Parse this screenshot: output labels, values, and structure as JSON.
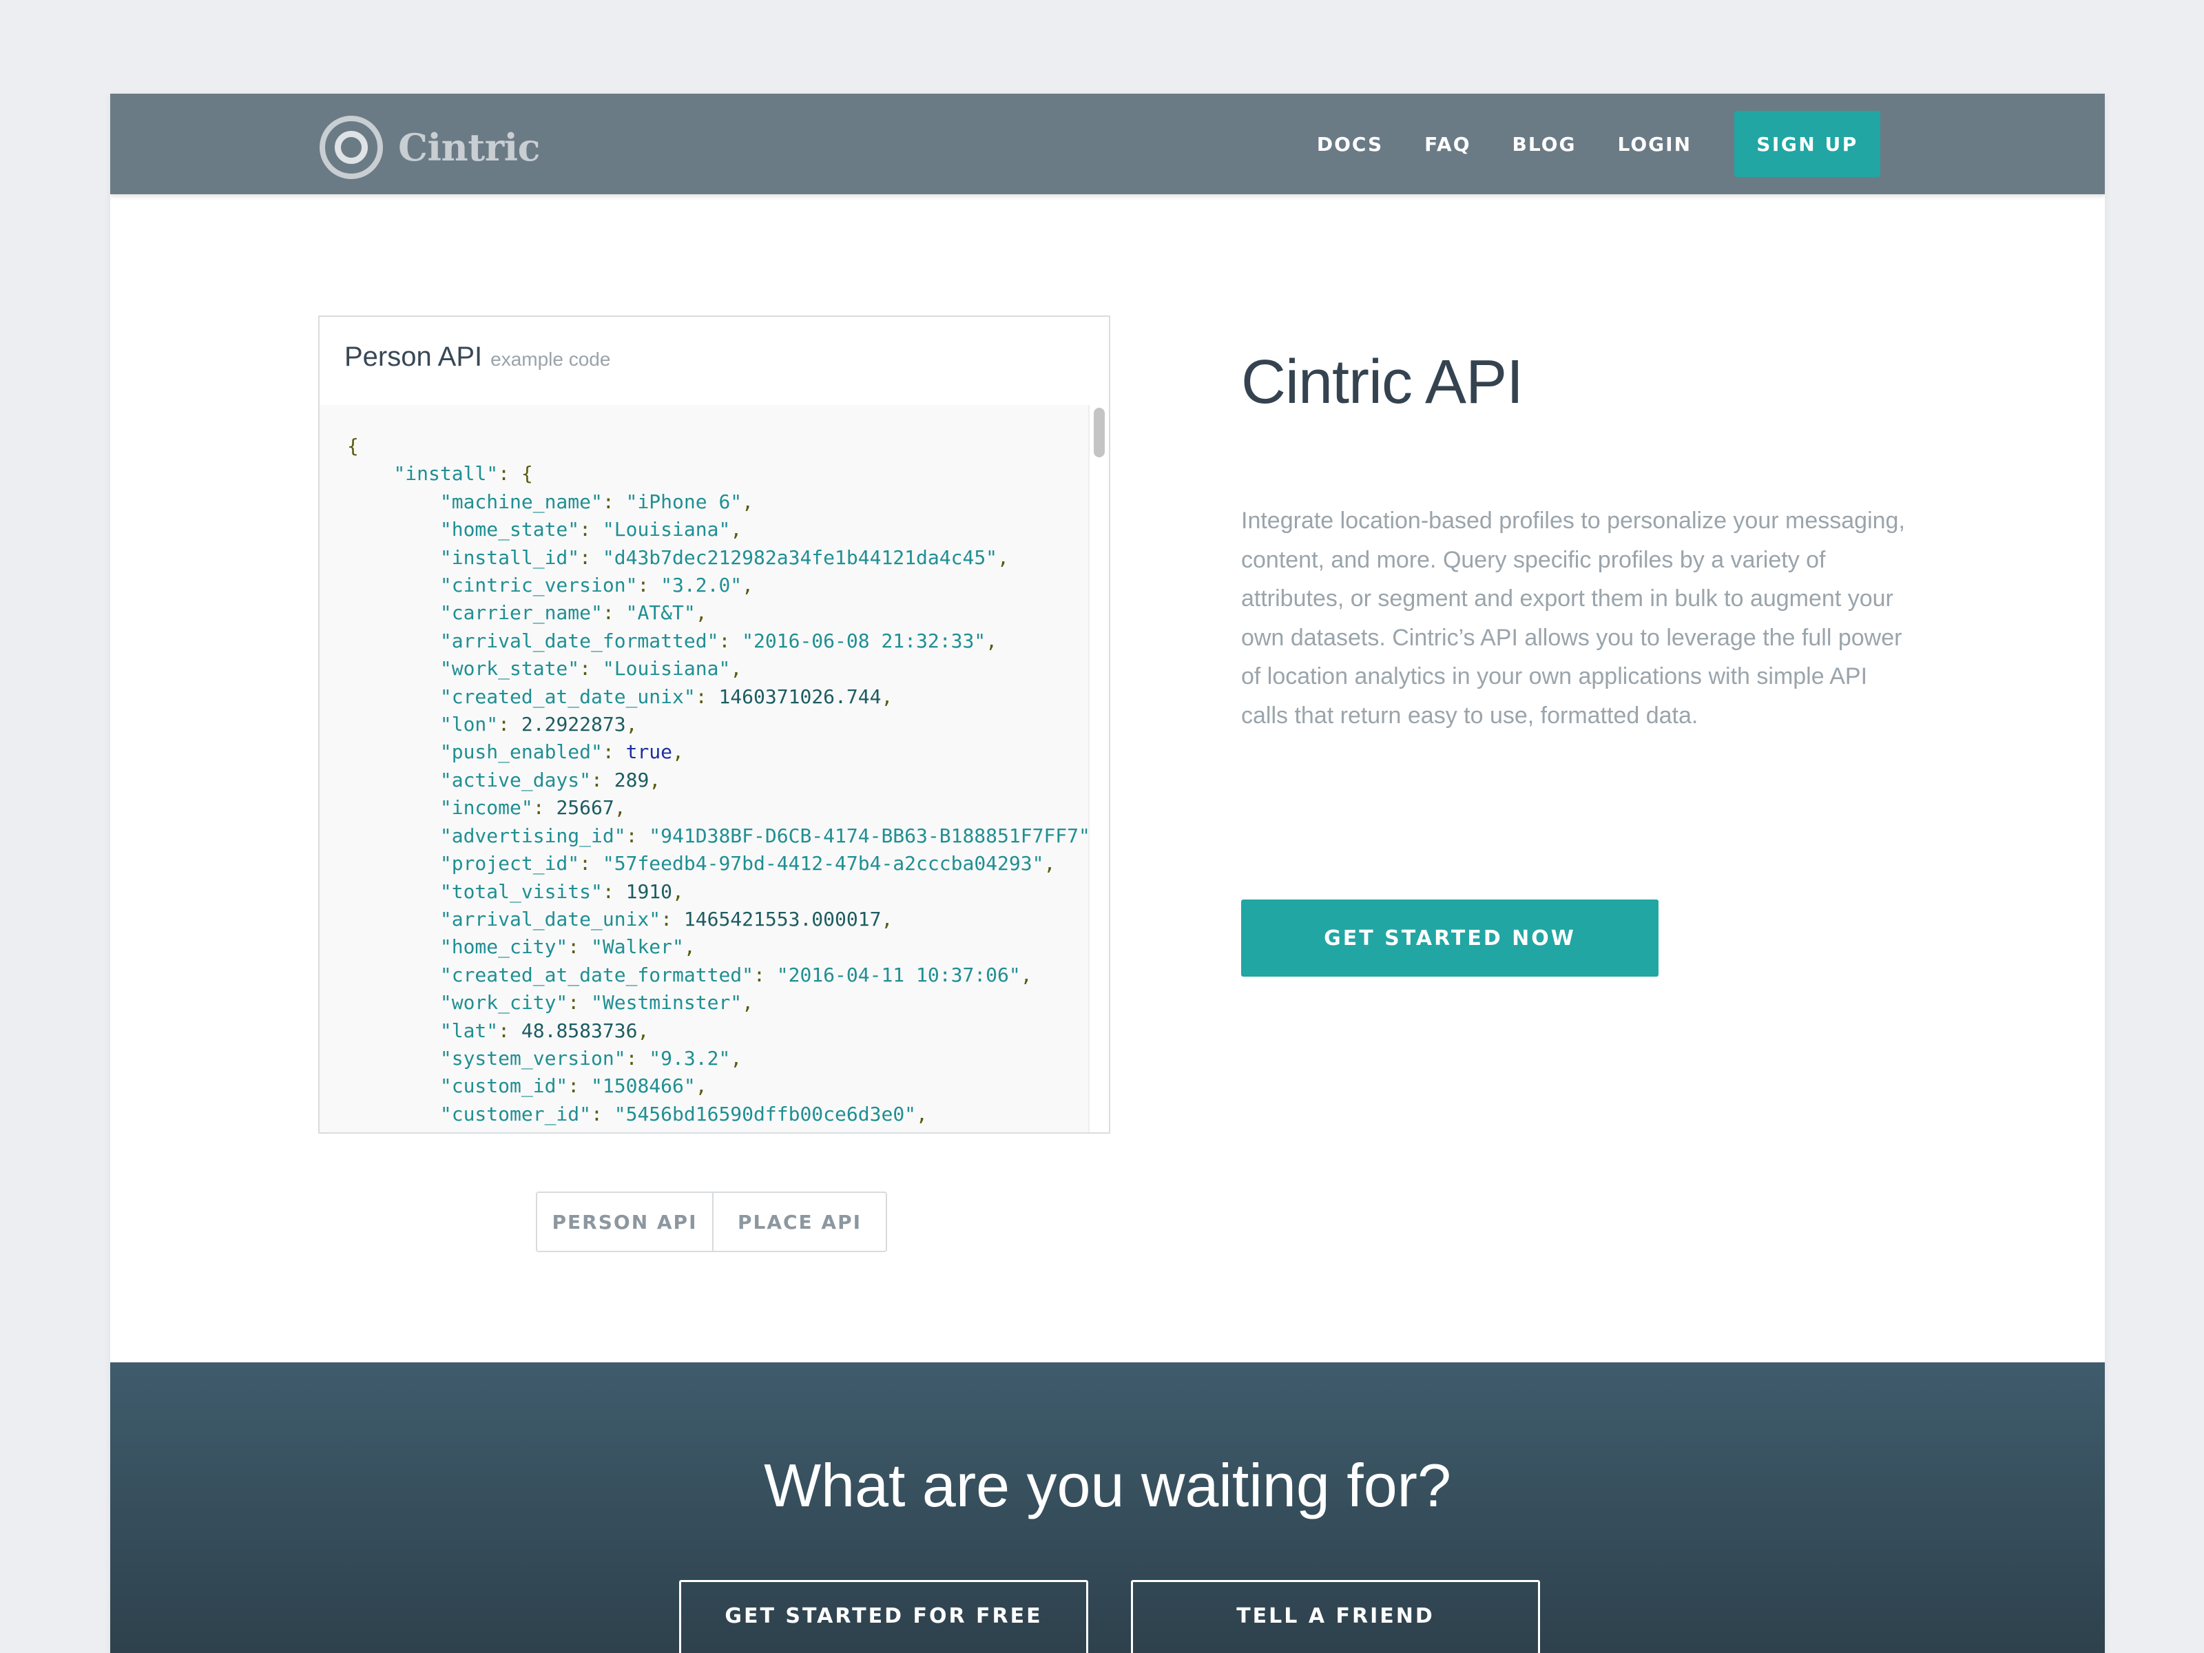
{
  "nav": {
    "logo_text": "Cintric",
    "links": [
      "DOCS",
      "FAQ",
      "BLOG",
      "LOGIN"
    ],
    "signup_label": "SIGN UP"
  },
  "code_panel": {
    "title": "Person API",
    "subtitle": "example code"
  },
  "code_lines": [
    {
      "key": "{",
      "type": "p"
    },
    {
      "key": "\"install\"",
      "value": "{",
      "type": "p",
      "indent": 1
    },
    {
      "key": "\"machine_name\"",
      "value": "\"iPhone 6\"",
      "type": "s",
      "indent": 2
    },
    {
      "key": "\"home_state\"",
      "value": "\"Louisiana\"",
      "type": "s",
      "indent": 2
    },
    {
      "key": "\"install_id\"",
      "value": "\"d43b7dec212982a34fe1b44121da4c45\"",
      "type": "s",
      "indent": 2
    },
    {
      "key": "\"cintric_version\"",
      "value": "\"3.2.0\"",
      "type": "s",
      "indent": 2
    },
    {
      "key": "\"carrier_name\"",
      "value": "\"AT&T\"",
      "type": "s",
      "indent": 2
    },
    {
      "key": "\"arrival_date_formatted\"",
      "value": "\"2016-06-08 21:32:33\"",
      "type": "s",
      "indent": 2
    },
    {
      "key": "\"work_state\"",
      "value": "\"Louisiana\"",
      "type": "s",
      "indent": 2
    },
    {
      "key": "\"created_at_date_unix\"",
      "value": "1460371026.744",
      "type": "n",
      "indent": 2
    },
    {
      "key": "\"lon\"",
      "value": "2.2922873",
      "type": "n",
      "indent": 2
    },
    {
      "key": "\"push_enabled\"",
      "value": "true",
      "type": "b",
      "indent": 2
    },
    {
      "key": "\"active_days\"",
      "value": "289",
      "type": "n",
      "indent": 2
    },
    {
      "key": "\"income\"",
      "value": "25667",
      "type": "n",
      "indent": 2
    },
    {
      "key": "\"advertising_id\"",
      "value": "\"941D38BF-D6CB-4174-BB63-B188851F7FF7\"",
      "type": "s",
      "indent": 2
    },
    {
      "key": "\"project_id\"",
      "value": "\"57feedb4-97bd-4412-47b4-a2cccba04293\"",
      "type": "s",
      "indent": 2
    },
    {
      "key": "\"total_visits\"",
      "value": "1910",
      "type": "n",
      "indent": 2
    },
    {
      "key": "\"arrival_date_unix\"",
      "value": "1465421553.000017",
      "type": "n",
      "indent": 2
    },
    {
      "key": "\"home_city\"",
      "value": "\"Walker\"",
      "type": "s",
      "indent": 2
    },
    {
      "key": "\"created_at_date_formatted\"",
      "value": "\"2016-04-11 10:37:06\"",
      "type": "s",
      "indent": 2
    },
    {
      "key": "\"work_city\"",
      "value": "\"Westminster\"",
      "type": "s",
      "indent": 2
    },
    {
      "key": "\"lat\"",
      "value": "48.8583736",
      "type": "n",
      "indent": 2
    },
    {
      "key": "\"system_version\"",
      "value": "\"9.3.2\"",
      "type": "s",
      "indent": 2
    },
    {
      "key": "\"custom_id\"",
      "value": "\"1508466\"",
      "type": "s",
      "indent": 2
    },
    {
      "key": "\"customer_id\"",
      "value": "\"5456bd16590dffb00ce6d3e0\"",
      "type": "s",
      "indent": 2
    }
  ],
  "toggle": {
    "person_label": "PERSON API",
    "place_label": "PLACE API"
  },
  "main": {
    "title": "Cintric API",
    "description": "Integrate location-based profiles to personalize your messaging, content, and more. Query specific profiles by a variety of attributes, or segment and export them in bulk to augment your own datasets. Cintric’s API allows you to leverage the full power of location analytics in your own applications with simple API calls that return easy to use, formatted data.",
    "cta_label": "GET STARTED NOW"
  },
  "cta_section": {
    "title": "What are you waiting for?",
    "free_label": "GET STARTED FOR FREE",
    "friend_label": "TELL A FRIEND"
  },
  "colors": {
    "nav_bg": "#6b7b86",
    "accent": "#21a6a3",
    "cta_bg_top": "#3f5c6c",
    "cta_bg_bottom": "#2e414d",
    "page_bg": "#eceef2"
  }
}
